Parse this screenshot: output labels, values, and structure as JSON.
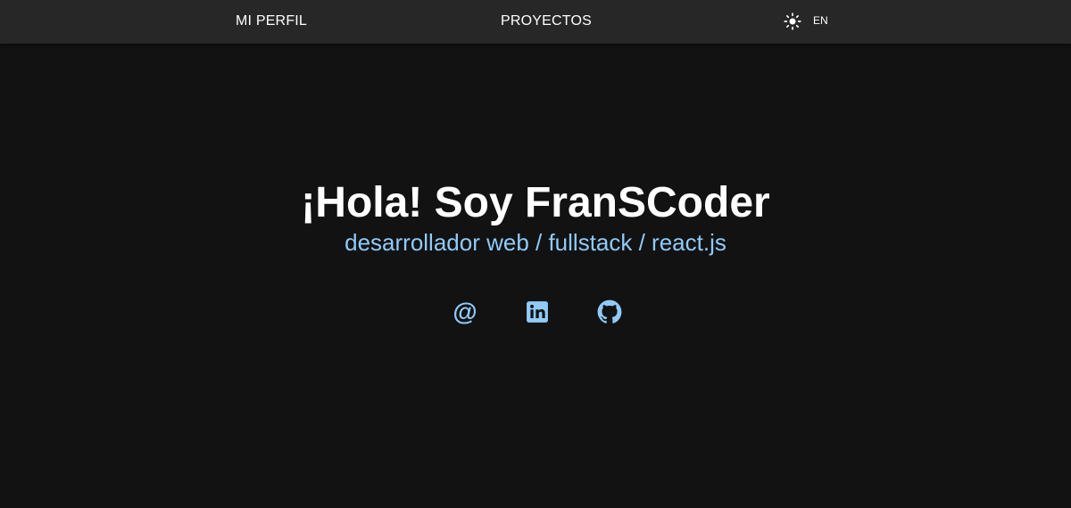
{
  "nav": {
    "perfil_label": "MI PERFIL",
    "proyectos_label": "PROYECTOS",
    "theme_icon": "sun-icon",
    "lang_label": "EN"
  },
  "hero": {
    "title": "¡Hola! Soy FranSCoder",
    "subtitle": "desarrollador web / fullstack / react.js"
  },
  "social": {
    "email_icon": "at-sign-icon",
    "email_glyph": "@",
    "linkedin_icon": "linkedin-icon",
    "github_icon": "github-icon"
  },
  "colors": {
    "background": "#121212",
    "topbar": "#272727",
    "accent": "#90caf9",
    "text": "#ffffff"
  }
}
